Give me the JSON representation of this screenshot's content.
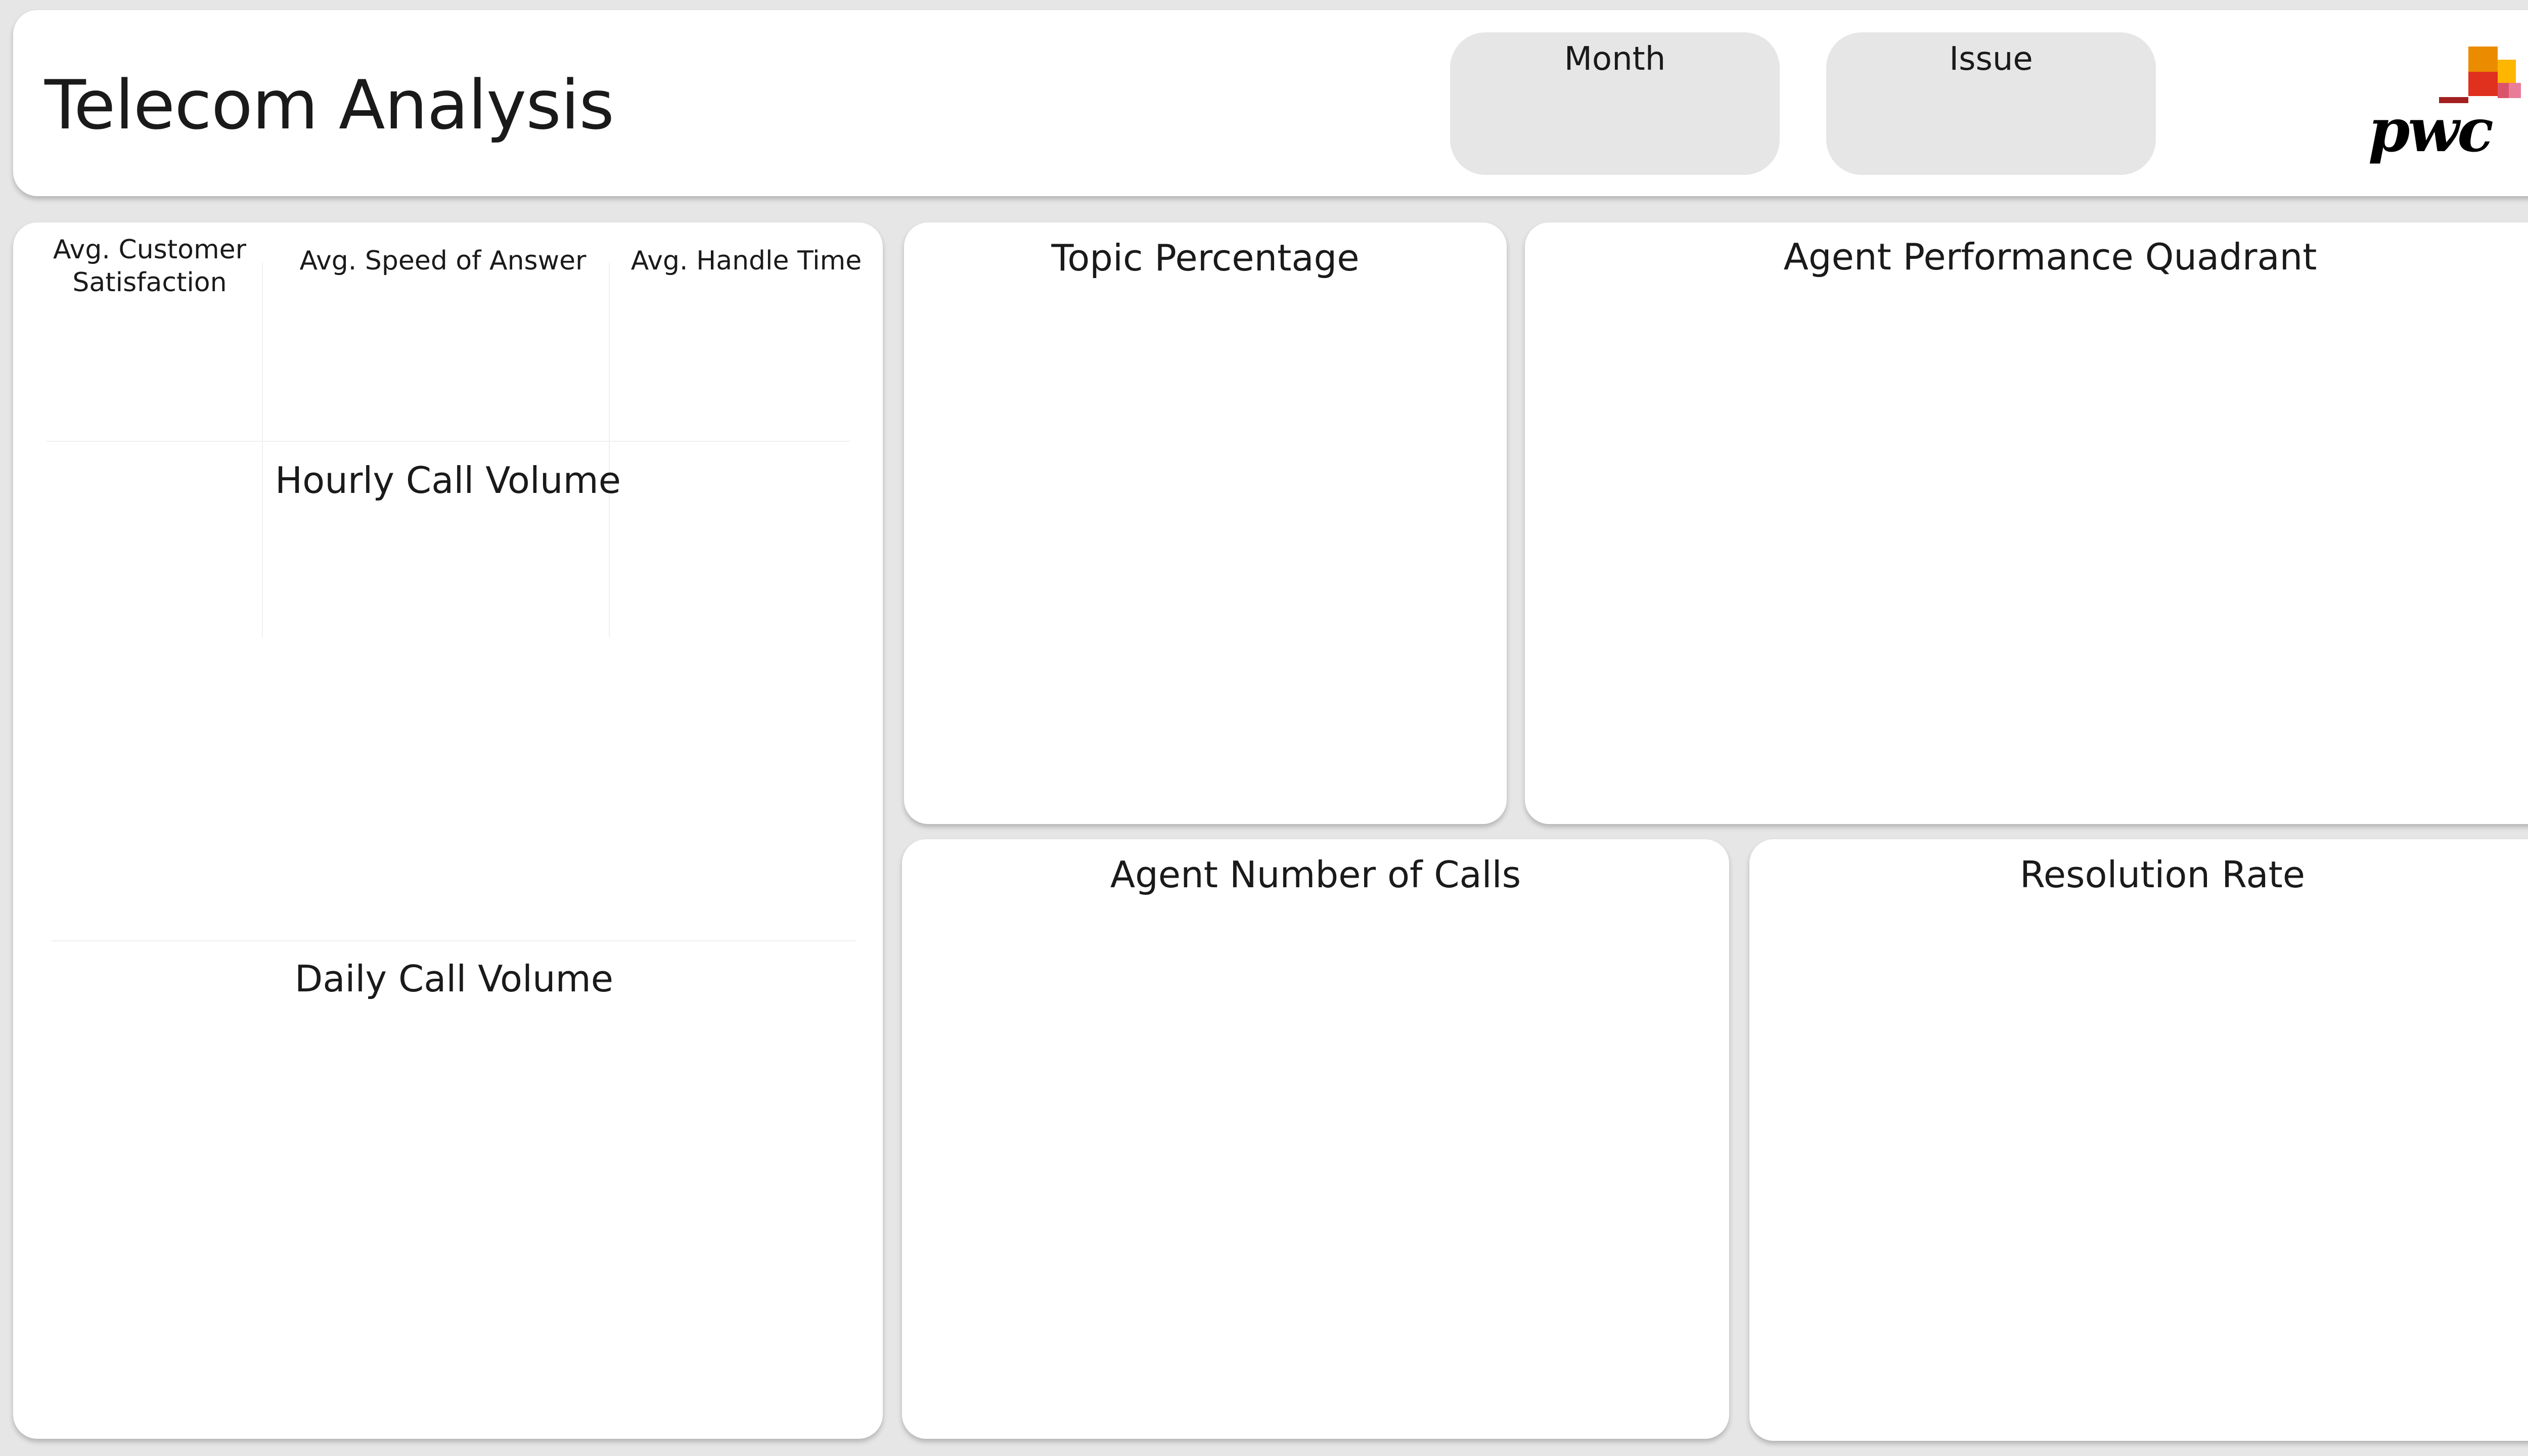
{
  "header": {
    "title": "Telecom Analysis",
    "slicers": [
      {
        "label": "Month"
      },
      {
        "label": "Issue"
      }
    ],
    "logo_text": "pwc"
  },
  "kpis": [
    {
      "label": "Avg. Customer Satisfaction",
      "line1": "Avg. Customer",
      "line2": "Satisfaction"
    },
    {
      "label": "Avg. Speed of Answer"
    },
    {
      "label": "Avg. Handle Time"
    }
  ],
  "sections": {
    "hourly": "Hourly Call Volume",
    "daily": "Daily Call Volume"
  },
  "panels": {
    "topic": "Topic Percentage",
    "quadrant": "Agent Performance Quadrant",
    "agent_calls": "Agent Number of Calls",
    "resolution": "Resolution Rate"
  },
  "colors": {
    "background": "#e6e6e6",
    "card": "#ffffff",
    "slicer": "#e6e6e6",
    "logo_orange": "#e0301e",
    "logo_amber": "#eb8c00",
    "logo_yellow": "#ffb600",
    "logo_pink": "#db536a",
    "logo_dark_red": "#a32020"
  }
}
